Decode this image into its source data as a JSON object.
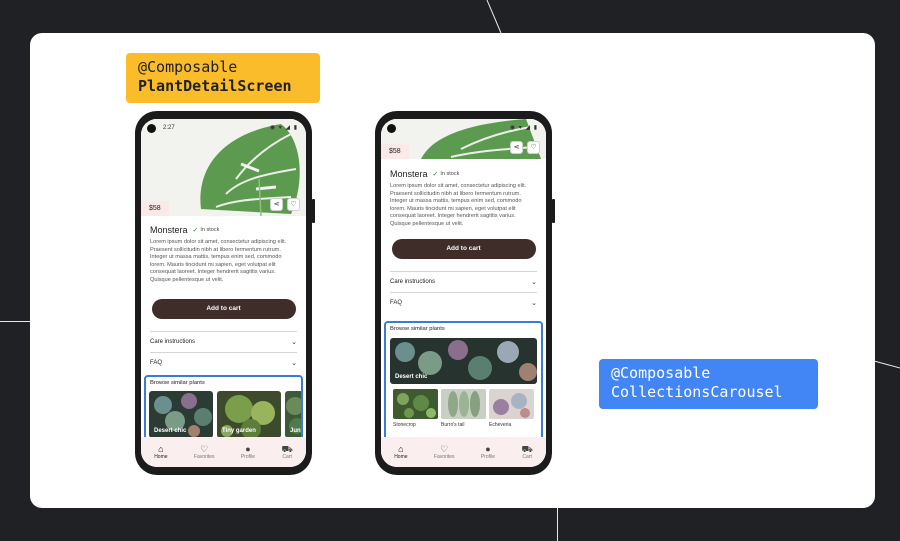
{
  "labels": {
    "left": {
      "line1": "@Composable",
      "line2": "PlantDetailScreen"
    },
    "right": {
      "line1": "@Composable",
      "line2": "CollectionsCarousel"
    }
  },
  "phones": [
    {
      "status_time": "2:27",
      "price": "$58",
      "title": "Monstera",
      "stock": "In stock",
      "description": "Lorem ipsum dolor sit amet, consectetur adipiscing elit. Praesent sollicitudin nibh at libero fermentum rutrum. Integer ut massa mattis, tempus enim sed, commodo lorem. Mauris tincidunt mi sapien, eget volutpat elit consequat laoreet. Integer hendrerit sagittis varius. Quisque pellentesque ut velit.",
      "add_to_cart": "Add to cart",
      "care": "Care instructions",
      "faq": "FAQ",
      "browse": "Browse similar plants",
      "collections": [
        "Desert chic",
        "Tiny garden",
        "Jun"
      ]
    },
    {
      "status_time": "",
      "price": "$58",
      "title": "Monstera",
      "stock": "In stock",
      "description": "Lorem ipsum dolor sit amet, consectetur adipiscing elit. Praesent sollicitudin nibh at libero fermentum rutrum. Integer ut massa mattis, tempus enim sed, commodo lorem. Mauris tincidunt mi sapien, eget volutpat elit consequat laoreet. Integer hendrerit sagittis varius. Quisque pellentesque ut velit.",
      "add_to_cart": "Add to cart",
      "care": "Care instructions",
      "faq": "FAQ",
      "browse": "Browse similar plants",
      "hero_collection": "Desert chic",
      "plants": [
        "Stonecrop",
        "Burro's tail",
        "Echeveria"
      ]
    }
  ],
  "nav": [
    "Home",
    "Favorites",
    "Profile",
    "Cart"
  ],
  "icons": {
    "share": "share-icon",
    "favorite": "heart-icon",
    "check": "check-icon",
    "chevron": "chevron-down-icon",
    "home": "home-icon",
    "profile": "profile-icon",
    "cart": "cart-icon"
  },
  "colors": {
    "background": "#202124",
    "card": "#ffffff",
    "tag_yellow": "#fbbc2c",
    "tag_blue": "#4285f4",
    "cart_button": "#3e2d29",
    "highlight_border": "#3a7bd5",
    "nav_bg": "#fbeeee",
    "price_bg": "#fbe9e7"
  }
}
